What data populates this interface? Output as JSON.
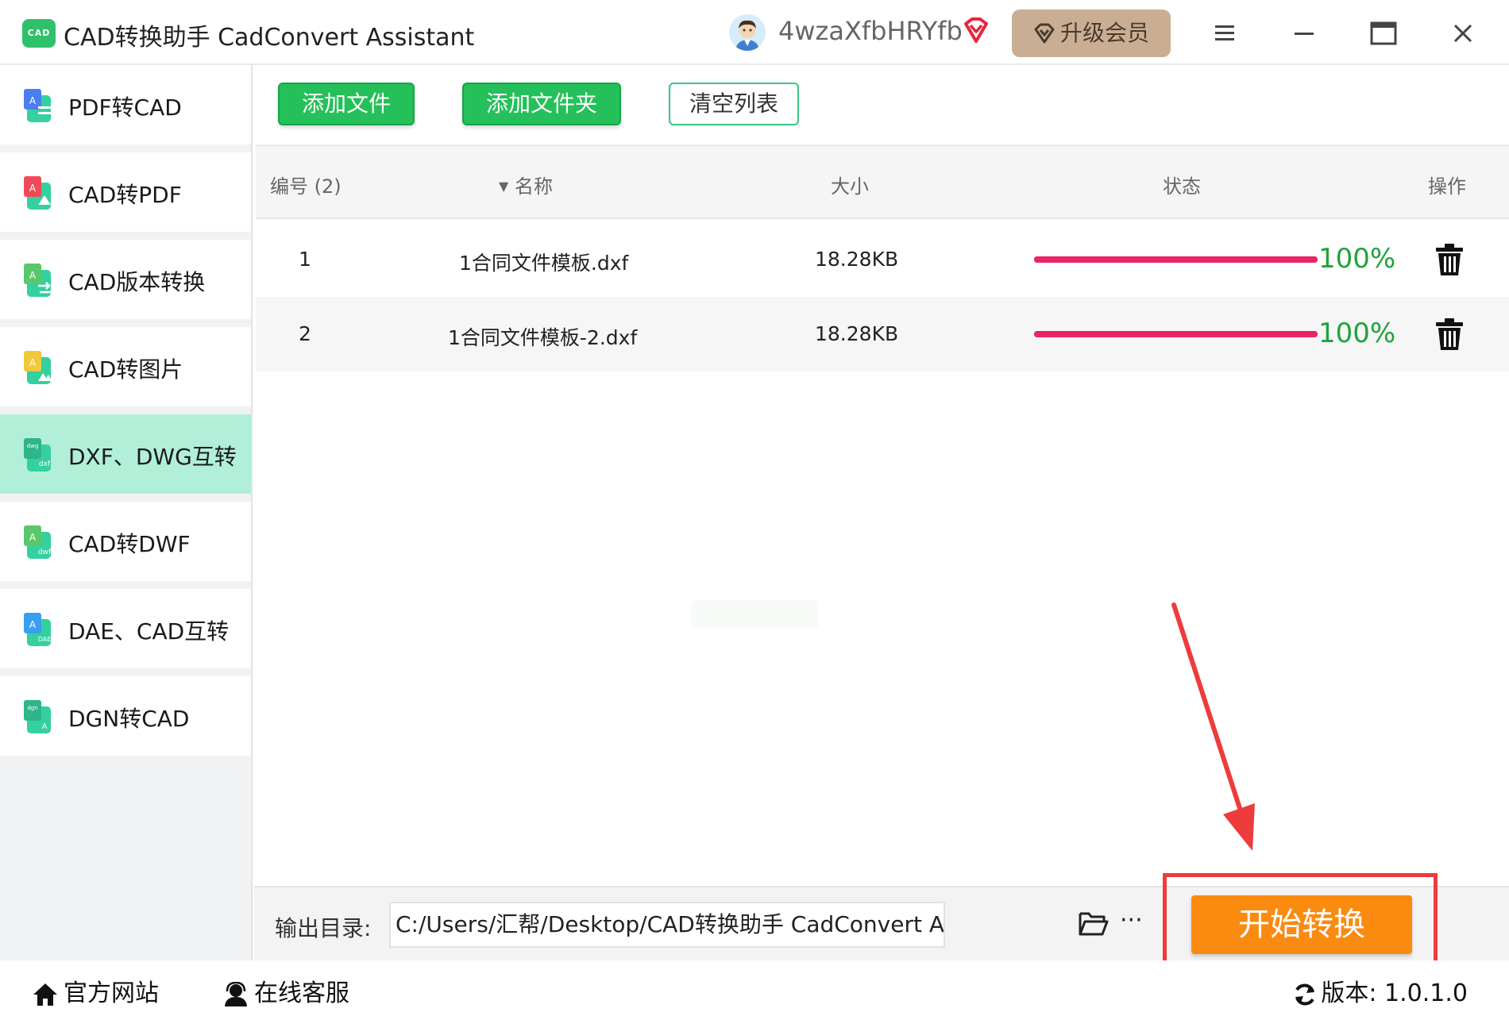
{
  "app": {
    "logo_text": "CAD",
    "title": "CAD转换助手 CadConvert Assistant",
    "username": "4wzaXfbHRYfb",
    "upgrade_label": "升级会员"
  },
  "sidebar": {
    "items": [
      {
        "label": "PDF转CAD",
        "icon": "pdf-to-cad-icon",
        "active": false
      },
      {
        "label": "CAD转PDF",
        "icon": "cad-to-pdf-icon",
        "active": false
      },
      {
        "label": "CAD版本转换",
        "icon": "cad-version-icon",
        "active": false
      },
      {
        "label": "CAD转图片",
        "icon": "cad-to-image-icon",
        "active": false
      },
      {
        "label": "DXF、DWG互转",
        "icon": "dxf-dwg-icon",
        "active": true
      },
      {
        "label": "CAD转DWF",
        "icon": "cad-to-dwf-icon",
        "active": false
      },
      {
        "label": "DAE、CAD互转",
        "icon": "dae-cad-icon",
        "active": false
      },
      {
        "label": "DGN转CAD",
        "icon": "dgn-to-cad-icon",
        "active": false
      }
    ]
  },
  "toolbar": {
    "add_file": "添加文件",
    "add_folder": "添加文件夹",
    "clear_list": "清空列表"
  },
  "table": {
    "headers": {
      "index": "编号 (2)",
      "name": "名称",
      "size": "大小",
      "status": "状态",
      "action": "操作"
    },
    "rows": [
      {
        "index": "1",
        "name": "1合同文件模板.dxf",
        "size": "18.28KB",
        "progress": 1.0,
        "percent": "100%"
      },
      {
        "index": "2",
        "name": "1合同文件模板-2.dxf",
        "size": "18.28KB",
        "progress": 1.0,
        "percent": "100%"
      }
    ]
  },
  "output": {
    "label": "输出目录:",
    "path": "C:/Users/汇帮/Desktop/CAD转换助手 CadConvert Assistant",
    "more": "···"
  },
  "start_button": "开始转换",
  "footer": {
    "website": "官方网站",
    "support": "在线客服",
    "version": "版本:  1.0.1.0"
  },
  "colors": {
    "accent_green": "#25c05a",
    "active_sidebar": "#b1efd9",
    "progress": "#e8246a",
    "percent_text": "#1fa33a",
    "start_button": "#fb8a10",
    "annotation_red": "#ee3b3b"
  }
}
